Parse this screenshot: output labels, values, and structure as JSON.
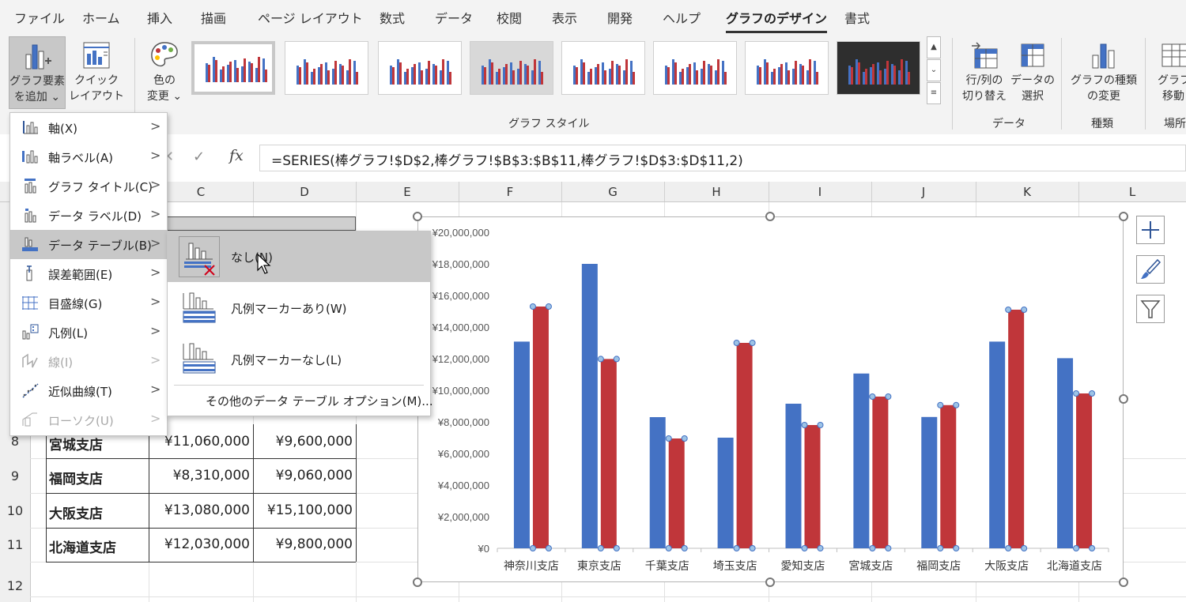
{
  "tabs": [
    "ファイル",
    "ホーム",
    "挿入",
    "描画",
    "ページ レイアウト",
    "数式",
    "データ",
    "校閲",
    "表示",
    "開発",
    "ヘルプ",
    "グラフのデザイン",
    "書式"
  ],
  "ribbon": {
    "add_element": [
      "グラフ要素",
      "を追加 ⌄"
    ],
    "quick_layout": [
      "クイック",
      "レイアウト ⌄"
    ],
    "colors": [
      "色の",
      "変更 ⌄"
    ],
    "styles_group": "グラフ スタイル",
    "switch_row_col": [
      "行/列の",
      "切り替え"
    ],
    "select_data": [
      "データの",
      "選択"
    ],
    "data_group": "データ",
    "change_type": [
      "グラフの種類",
      "の変更"
    ],
    "type_group": "種類",
    "move_chart": [
      "グラフの",
      "移動"
    ],
    "location_group": "場所"
  },
  "formula_bar": {
    "cancel": "✕",
    "enter": "✓",
    "fx": "fx",
    "formula": "=SERIES(棒グラフ!$D$2,棒グラフ!$B$3:$B$11,棒グラフ!$D$3:$D$11,2)"
  },
  "columns": [
    "C",
    "D",
    "E",
    "F",
    "G",
    "H",
    "I",
    "J",
    "K",
    "L"
  ],
  "rows": [
    "8",
    "9",
    "10",
    "11",
    "12"
  ],
  "table": [
    {
      "name": "宮城支店",
      "c": "¥11,060,000",
      "d": "¥9,600,000"
    },
    {
      "name": "福岡支店",
      "c": "¥8,310,000",
      "d": "¥9,060,000"
    },
    {
      "name": "大阪支店",
      "c": "¥13,080,000",
      "d": "¥15,100,000"
    },
    {
      "name": "北海道支店",
      "c": "¥12,030,000",
      "d": "¥9,800,000"
    }
  ],
  "menu": [
    {
      "label": "軸(X)",
      "icon": "axis-icon",
      "disabled": false
    },
    {
      "label": "軸ラベル(A)",
      "icon": "axis-label-icon",
      "disabled": false
    },
    {
      "label": "グラフ タイトル(C)",
      "icon": "chart-title-icon",
      "disabled": false
    },
    {
      "label": "データ ラベル(D)",
      "icon": "data-label-icon",
      "disabled": false
    },
    {
      "label": "データ テーブル(B)",
      "icon": "data-table-icon",
      "disabled": false,
      "highlighted": true
    },
    {
      "label": "誤差範囲(E)",
      "icon": "error-bars-icon",
      "disabled": false
    },
    {
      "label": "目盛線(G)",
      "icon": "gridlines-icon",
      "disabled": false
    },
    {
      "label": "凡例(L)",
      "icon": "legend-icon",
      "disabled": false
    },
    {
      "label": "線(I)",
      "icon": "lines-icon",
      "disabled": true
    },
    {
      "label": "近似曲線(T)",
      "icon": "trendline-icon",
      "disabled": false
    },
    {
      "label": "ローソク(U)",
      "icon": "up-down-bars-icon",
      "disabled": true
    }
  ],
  "submenu": {
    "items": [
      "なし(N)",
      "凡例マーカーあり(W)",
      "凡例マーカーなし(L)"
    ],
    "more": "その他のデータ テーブル オプション(M)..."
  },
  "colors": {
    "series1": "#4472c4",
    "series2": "#c0363a",
    "highlight": "#c8c8c8",
    "ribbon_bg": "#f3f3f3"
  },
  "chart_data": {
    "type": "bar",
    "categories": [
      "神奈川支店",
      "東京支店",
      "千葉支店",
      "埼玉支店",
      "愛知支店",
      "宮城支店",
      "福岡支店",
      "大阪支店",
      "北海道支店"
    ],
    "series": [
      {
        "values": [
          13080000,
          18000000,
          8300000,
          7000000,
          9150000,
          11060000,
          8310000,
          13080000,
          12030000
        ]
      },
      {
        "values": [
          15300000,
          11980000,
          6950000,
          13000000,
          7800000,
          9600000,
          9060000,
          15100000,
          9800000
        ]
      }
    ],
    "y_ticks": [
      "¥0",
      "¥2,000,000",
      "¥4,000,000",
      "¥6,000,000",
      "¥8,000,000",
      "¥10,000,000",
      "¥12,000,000",
      "¥14,000,000",
      "¥16,000,000",
      "¥18,000,000",
      "¥20,000,000"
    ],
    "ylim": [
      0,
      20000000
    ],
    "selected_series": 2
  }
}
